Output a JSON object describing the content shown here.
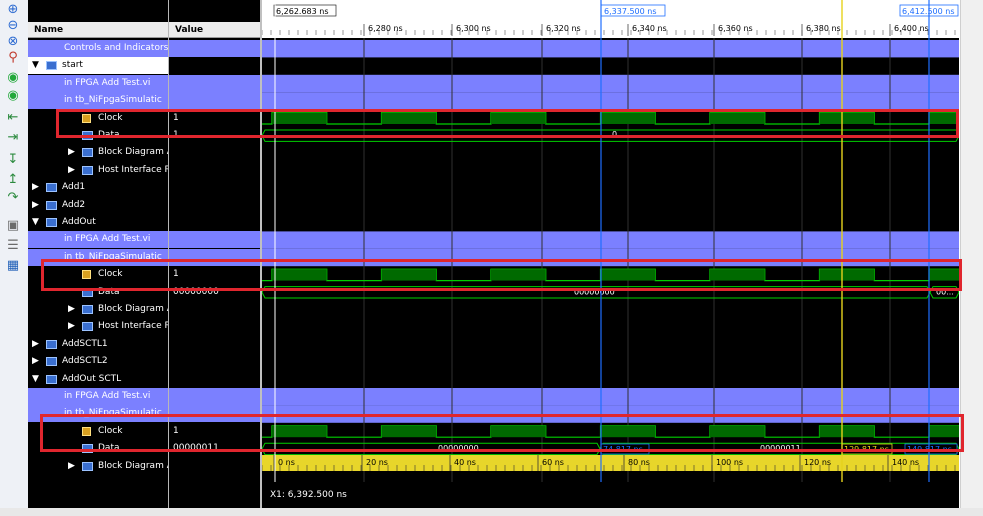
{
  "toolbar": {
    "icons": [
      "zoom-in-icon",
      "zoom-out-icon",
      "zoom-fit-icon",
      "marker-icon",
      "go-start-icon",
      "go-end-icon",
      "step-back-icon",
      "step-forward-icon",
      "step-in-icon",
      "step-out-icon",
      "step-over-icon",
      "save-icon",
      "list-view-icon",
      "table-view-icon"
    ]
  },
  "columns": {
    "name": "Name",
    "value": "Value"
  },
  "rows": [
    {
      "label": "Controls and Indicators",
      "type": "section",
      "indent": 0,
      "value": ""
    },
    {
      "label": "start",
      "type": "group-open",
      "indent": 0,
      "value": ""
    },
    {
      "label": "in FPGA Add Test.vi",
      "type": "section",
      "indent": 1,
      "value": ""
    },
    {
      "label": "in tb_NiFpgaSimulatic",
      "type": "section",
      "indent": 1,
      "value": ""
    },
    {
      "label": "Clock",
      "type": "clock",
      "indent": 2,
      "value": "1"
    },
    {
      "label": "Data",
      "type": "data",
      "indent": 2,
      "value": "1"
    },
    {
      "label": "Block Diagram Ac",
      "type": "group",
      "indent": 2,
      "value": ""
    },
    {
      "label": "Host Interface Re",
      "type": "group",
      "indent": 2,
      "value": ""
    },
    {
      "label": "Add1",
      "type": "group",
      "indent": 0,
      "value": ""
    },
    {
      "label": "Add2",
      "type": "group",
      "indent": 0,
      "value": ""
    },
    {
      "label": "AddOut",
      "type": "group-open",
      "indent": 0,
      "value": ""
    },
    {
      "label": "in FPGA Add Test.vi",
      "type": "section",
      "indent": 1,
      "value": ""
    },
    {
      "label": "in tb_NiFpgaSimulatic",
      "type": "section",
      "indent": 1,
      "value": ""
    },
    {
      "label": "Clock",
      "type": "clock",
      "indent": 2,
      "value": "1"
    },
    {
      "label": "Data",
      "type": "data",
      "indent": 2,
      "value": "00000000"
    },
    {
      "label": "Block Diagram Ac",
      "type": "group",
      "indent": 2,
      "value": ""
    },
    {
      "label": "Host Interface Re",
      "type": "group",
      "indent": 2,
      "value": ""
    },
    {
      "label": "AddSCTL1",
      "type": "group",
      "indent": 0,
      "value": ""
    },
    {
      "label": "AddSCTL2",
      "type": "group",
      "indent": 0,
      "value": ""
    },
    {
      "label": "AddOut SCTL",
      "type": "group-open",
      "indent": 0,
      "value": ""
    },
    {
      "label": "in FPGA Add Test.vi",
      "type": "section",
      "indent": 1,
      "value": ""
    },
    {
      "label": "in tb_NiFpgaSimulatic",
      "type": "section",
      "indent": 1,
      "value": ""
    },
    {
      "label": "Clock",
      "type": "clock",
      "indent": 2,
      "value": "1"
    },
    {
      "label": "Data",
      "type": "data",
      "indent": 2,
      "value": "00000011"
    },
    {
      "label": "Block Diagram Ac",
      "type": "group",
      "indent": 2,
      "value": ""
    }
  ],
  "timeline": {
    "start_label": "6,262.683 ns",
    "cursor_blue_label": "6,337.500 ns",
    "cursor_right_label": "6,412.500 ns",
    "ticks": [
      "6,280 ns",
      "6,300 ns",
      "6,320 ns",
      "6,340 ns",
      "6,360 ns",
      "6,380 ns",
      "6,400 ns"
    ],
    "bottom_ticks": [
      "0 ns",
      "20 ns",
      "40 ns",
      "60 ns",
      "80 ns",
      "100 ns",
      "120 ns",
      "140 ns"
    ],
    "delta_blue": "74.817 ns",
    "delta_yellow": "129.817 ns",
    "delta_right": "149.817 ns",
    "data_values": {
      "start": "0",
      "addout": "00000000",
      "addout_end": "00...",
      "sctl_a": "00000000",
      "sctl_b": "00000011"
    }
  },
  "status": {
    "cursor": "X1: 6,392.500 ns"
  },
  "colors": {
    "section": "#7b80ff",
    "wave": "#00d000",
    "cursor_blue": "#1e6eff",
    "cursor_yellow": "#e6d21c",
    "highlight": "#e0262e",
    "bottom_axis": "#e8d62a"
  }
}
